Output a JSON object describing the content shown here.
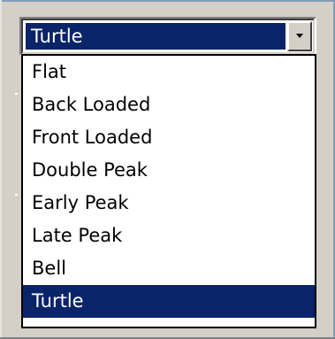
{
  "combo": {
    "selected_value": "Turtle",
    "dropdown_icon": "chevron-down-icon"
  },
  "dropdown": {
    "items": [
      {
        "label": "Flat",
        "selected": false
      },
      {
        "label": "Back Loaded",
        "selected": false
      },
      {
        "label": "Front Loaded",
        "selected": false
      },
      {
        "label": "Double Peak",
        "selected": false
      },
      {
        "label": "Early Peak",
        "selected": false
      },
      {
        "label": "Late Peak",
        "selected": false
      },
      {
        "label": "Bell",
        "selected": false
      },
      {
        "label": "Turtle",
        "selected": true
      }
    ]
  },
  "colors": {
    "selection_bg": "#0a246a",
    "selection_fg": "#ffffff",
    "window_bg": "#d4d0c8",
    "frame_accent": "#7f9db9"
  }
}
